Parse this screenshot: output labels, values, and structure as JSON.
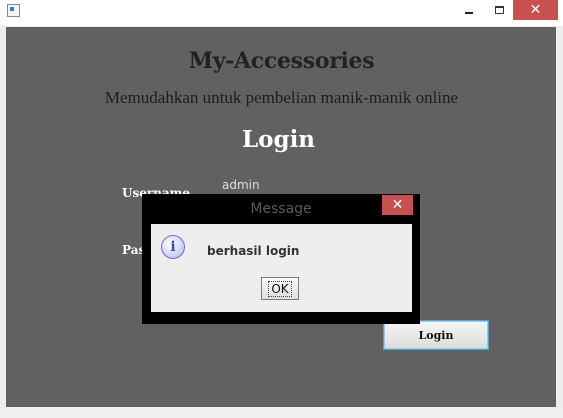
{
  "window": {
    "minimize_symbol": "",
    "maximize_symbol": "",
    "close_symbol": "✕"
  },
  "app": {
    "title": "My-Accessories",
    "subtitle": "Memudahkan untuk pembelian manik-manik online"
  },
  "login_form": {
    "heading": "Login",
    "username_label": "Username",
    "username_value": "admin",
    "password_label": "Password",
    "login_button_label": "Login"
  },
  "dialog": {
    "title": "Message",
    "close_symbol": "✕",
    "icon": "info-icon",
    "icon_glyph": "i",
    "message": "berhasil login",
    "ok_label": "OK"
  },
  "colors": {
    "panel_background": "#616161",
    "window_close_red": "#c75050",
    "dialog_border": "#000000"
  }
}
